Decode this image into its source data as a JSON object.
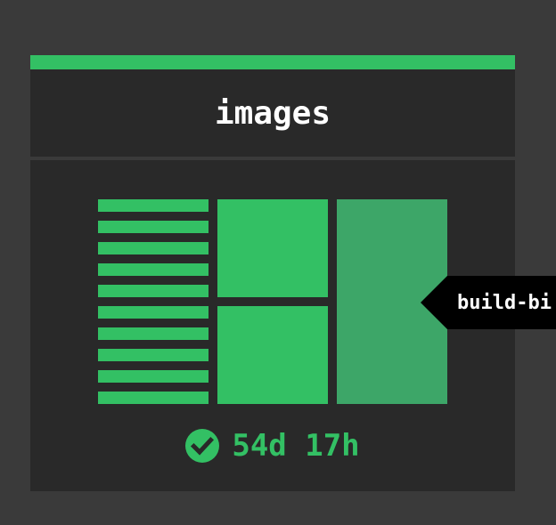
{
  "pipeline": {
    "name": "images"
  },
  "jobs": {
    "tooltip": "build-bi"
  },
  "status": {
    "icon": "check-circle-icon",
    "elapsed": "54d 17h"
  },
  "colors": {
    "background": "#3a3a3a",
    "card": "#292929",
    "succeeded": "#33c064",
    "running": "#3da668",
    "tooltip_bg": "#000000"
  }
}
